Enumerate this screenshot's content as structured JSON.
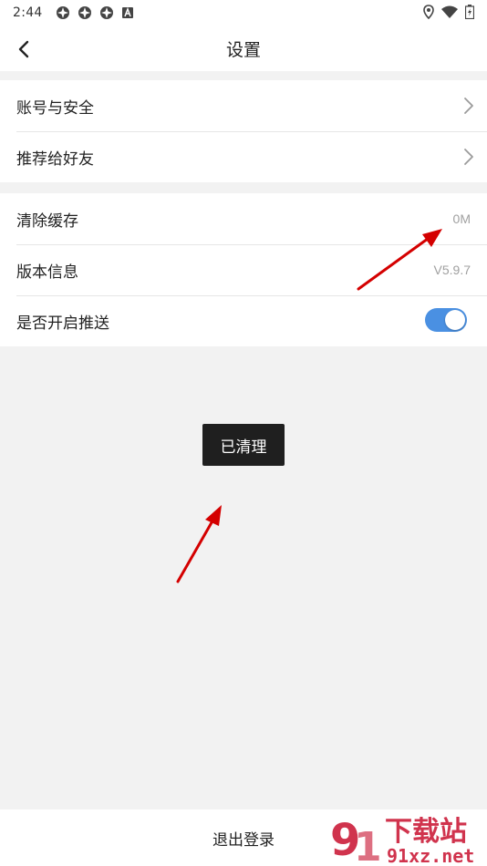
{
  "status_bar": {
    "time": "2:44",
    "left_icons": [
      "app-notification-icon",
      "app-notification-icon",
      "app-notification-icon",
      "accessibility-icon"
    ],
    "right_icons": [
      "location-icon",
      "wifi-icon",
      "battery-icon"
    ]
  },
  "header": {
    "title": "设置"
  },
  "groups": {
    "account": {
      "items": [
        {
          "label": "账号与安全"
        },
        {
          "label": "推荐给好友"
        }
      ]
    },
    "system": {
      "clear_cache": {
        "label": "清除缓存",
        "value": "0M"
      },
      "version": {
        "label": "版本信息",
        "value": "V5.9.7"
      },
      "push": {
        "label": "是否开启推送",
        "enabled": true
      }
    }
  },
  "toast": {
    "text": "已清理"
  },
  "footer": {
    "logout_label": "退出登录"
  },
  "watermark": {
    "brand": "下载站",
    "site": "91xz.net"
  },
  "colors": {
    "toggle_on": "#4a90e2",
    "annotation_arrow": "#d40000",
    "watermark": "#c8102e"
  }
}
